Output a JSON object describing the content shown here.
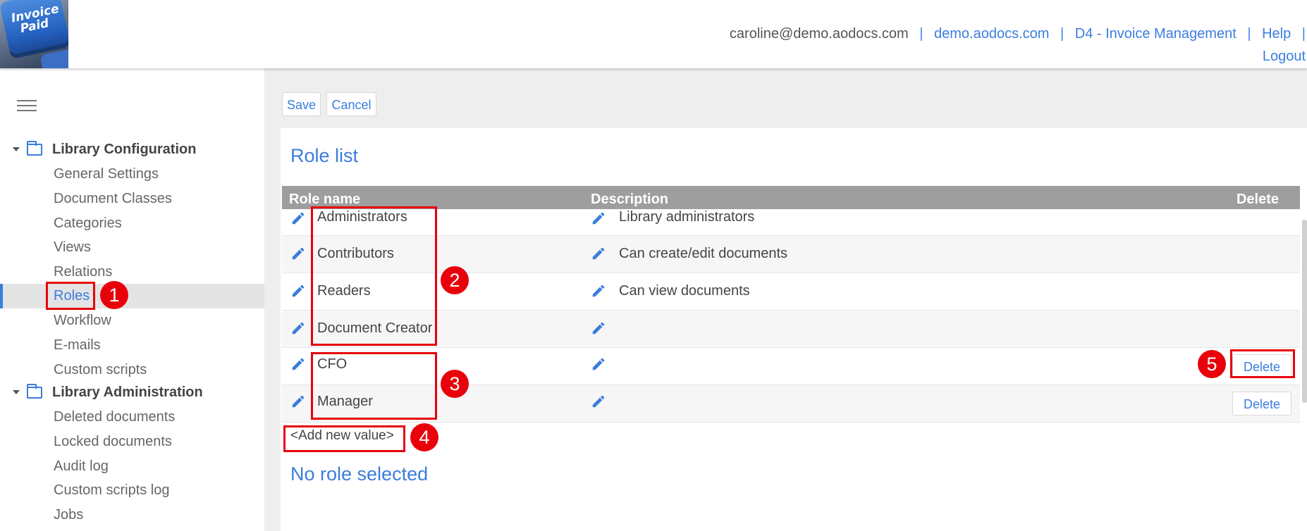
{
  "header": {
    "logo_text": "Invoice Paid",
    "user_email": "caroline@demo.aodocs.com",
    "links": [
      "demo.aodocs.com",
      "D4 - Invoice Management",
      "Help"
    ],
    "logout": "Logout",
    "separator": "|"
  },
  "sidebar": {
    "sections": [
      {
        "label": "Library Configuration",
        "items": [
          "General Settings",
          "Document Classes",
          "Categories",
          "Views",
          "Relations",
          "Roles",
          "Workflow",
          "E-mails",
          "Custom scripts"
        ]
      },
      {
        "label": "Library Administration",
        "items": [
          "Deleted documents",
          "Locked documents",
          "Audit log",
          "Custom scripts log",
          "Jobs"
        ]
      }
    ],
    "active_item": "Roles"
  },
  "toolbar": {
    "save": "Save",
    "cancel": "Cancel"
  },
  "main": {
    "title": "Role list",
    "columns": {
      "name": "Role name",
      "description": "Description",
      "delete": "Delete"
    },
    "rows": [
      {
        "name": "Administrators",
        "description": "Library administrators",
        "delete": ""
      },
      {
        "name": "Contributors",
        "description": "Can create/edit documents",
        "delete": ""
      },
      {
        "name": "Readers",
        "description": "Can view documents",
        "delete": ""
      },
      {
        "name": "Document Creator",
        "description": "",
        "delete": ""
      },
      {
        "name": "CFO",
        "description": "",
        "delete": "Delete"
      },
      {
        "name": "Manager",
        "description": "",
        "delete": "Delete"
      }
    ],
    "add_new": "<Add new value>",
    "no_selection": "No role selected"
  },
  "annotations": [
    "1",
    "2",
    "3",
    "4",
    "5"
  ],
  "colors": {
    "accent": "#3b7ddd",
    "annotation": "#e8000b",
    "header_row": "#9e9e9e"
  }
}
